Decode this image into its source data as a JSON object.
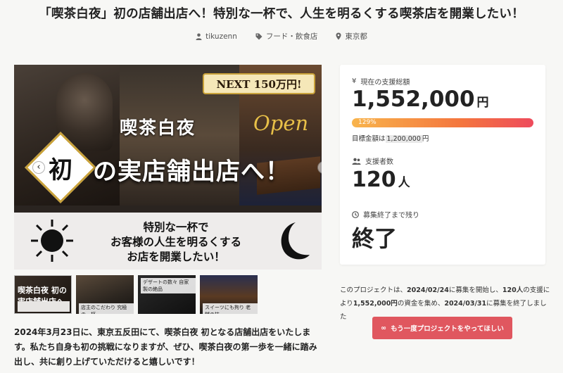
{
  "project": {
    "title": "「喫茶白夜」初の店舗出店へ！特別な一杯で、人生を明るくする喫茶店を開業したい！",
    "author": "tikuzenn",
    "category": "フード・飲食店",
    "location": "東京都"
  },
  "hero": {
    "next_badge": "NEXT 150万円!",
    "store_name": "喫茶白夜",
    "open_word": "Open",
    "first_char": "初",
    "headline": "の実店舗出店へ！",
    "banner_lines": [
      "特別な一杯で",
      "お客様の人生を明るくする",
      "お店を開業したい！"
    ],
    "prev_icon": "chevron-left-icon",
    "next_icon": "chevron-right-icon"
  },
  "thumbnails": [
    {
      "caption": "喫茶白夜 初の実店舗出店へ"
    },
    {
      "caption": "店主のこだわり 究極の一杯"
    },
    {
      "caption": "デザートの数々 自家製の絶品"
    },
    {
      "caption": "スイーツにも拘り 老舗の技"
    }
  ],
  "description": "2024年3月23日に、東京五反田にて、喫茶白夜 初となる店舗出店をいたします。私たち自身も初の挑戦になりますが、ぜひ、喫茶白夜の第一歩を一緒に踏み出し、共に創り上げていただけると嬉しいです！",
  "stats": {
    "raised_label": "現在の支援総額",
    "raised_amount": "1,552,000",
    "raised_unit": "円",
    "percent": "129%",
    "percent_value": 129,
    "goal_prefix": "目標金額は",
    "goal_amount": "1,200,000",
    "goal_unit": "円",
    "backers_label": "支援者数",
    "backers_count": "120",
    "backers_unit": "人",
    "remaining_label": "募集終了まで残り",
    "remaining_value": "終了"
  },
  "summary": {
    "prefix": "このプロジェクトは、",
    "start_date": "2024/02/24",
    "mid1": "に募集を開始し、",
    "backers": "120人",
    "mid2": "の支援により",
    "amount": "1,552,000円",
    "mid3": "の資金を集め、",
    "end_date": "2024/03/31",
    "suffix": "に募集を終了しました"
  },
  "cta": {
    "label": "もう一度プロジェクトをやってほしい",
    "icon": "infinity-icon"
  },
  "colors": {
    "accent": "#e0575f",
    "bar_start": "#f8b44c",
    "bar_end": "#ee4b5c",
    "background": "#f7f7f5"
  }
}
